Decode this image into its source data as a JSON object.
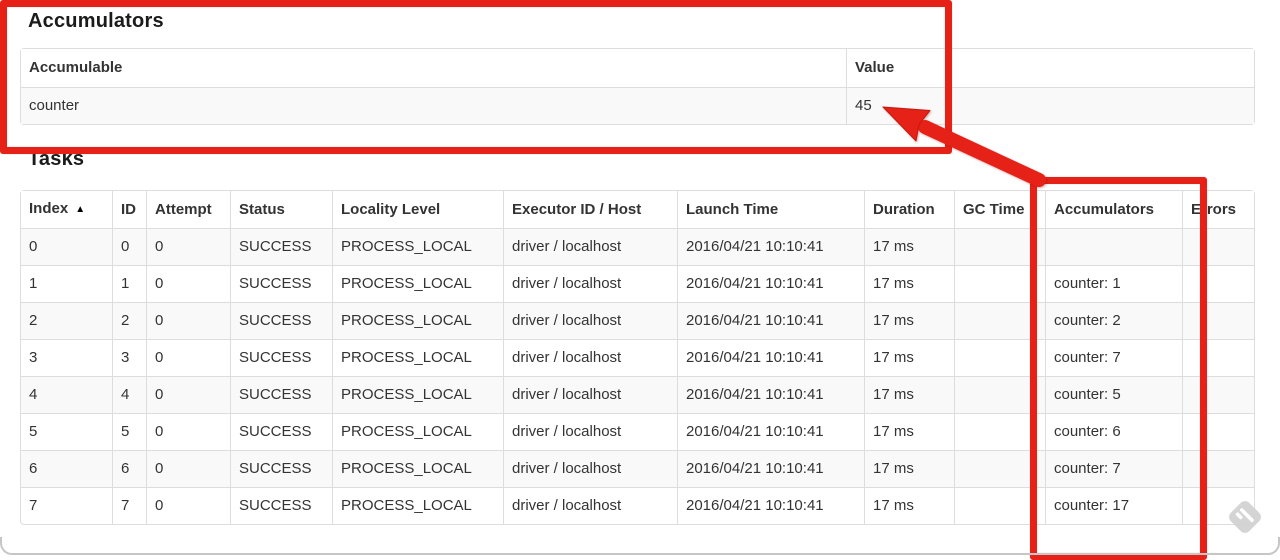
{
  "accumulators_section": {
    "heading": "Accumulators",
    "table": {
      "headers": [
        "Accumulable",
        "Value"
      ],
      "rows": [
        [
          "counter",
          "45"
        ]
      ]
    }
  },
  "tasks_section": {
    "heading": "Tasks",
    "sort_icon": "▲",
    "table": {
      "headers": [
        "Index",
        "ID",
        "Attempt",
        "Status",
        "Locality Level",
        "Executor ID / Host",
        "Launch Time",
        "Duration",
        "GC Time",
        "Accumulators",
        "Errors"
      ],
      "rows": [
        [
          "0",
          "0",
          "0",
          "SUCCESS",
          "PROCESS_LOCAL",
          "driver / localhost",
          "2016/04/21 10:10:41",
          "17 ms",
          "",
          "",
          ""
        ],
        [
          "1",
          "1",
          "0",
          "SUCCESS",
          "PROCESS_LOCAL",
          "driver / localhost",
          "2016/04/21 10:10:41",
          "17 ms",
          "",
          "counter: 1",
          ""
        ],
        [
          "2",
          "2",
          "0",
          "SUCCESS",
          "PROCESS_LOCAL",
          "driver / localhost",
          "2016/04/21 10:10:41",
          "17 ms",
          "",
          "counter: 2",
          ""
        ],
        [
          "3",
          "3",
          "0",
          "SUCCESS",
          "PROCESS_LOCAL",
          "driver / localhost",
          "2016/04/21 10:10:41",
          "17 ms",
          "",
          "counter: 7",
          ""
        ],
        [
          "4",
          "4",
          "0",
          "SUCCESS",
          "PROCESS_LOCAL",
          "driver / localhost",
          "2016/04/21 10:10:41",
          "17 ms",
          "",
          "counter: 5",
          ""
        ],
        [
          "5",
          "5",
          "0",
          "SUCCESS",
          "PROCESS_LOCAL",
          "driver / localhost",
          "2016/04/21 10:10:41",
          "17 ms",
          "",
          "counter: 6",
          ""
        ],
        [
          "6",
          "6",
          "0",
          "SUCCESS",
          "PROCESS_LOCAL",
          "driver / localhost",
          "2016/04/21 10:10:41",
          "17 ms",
          "",
          "counter: 7",
          ""
        ],
        [
          "7",
          "7",
          "0",
          "SUCCESS",
          "PROCESS_LOCAL",
          "driver / localhost",
          "2016/04/21 10:10:41",
          "17 ms",
          "",
          "counter: 17",
          ""
        ]
      ]
    }
  },
  "annotations": {
    "color": "#e62117"
  },
  "watermark_icon": "diamond-stripes-watermark-icon"
}
